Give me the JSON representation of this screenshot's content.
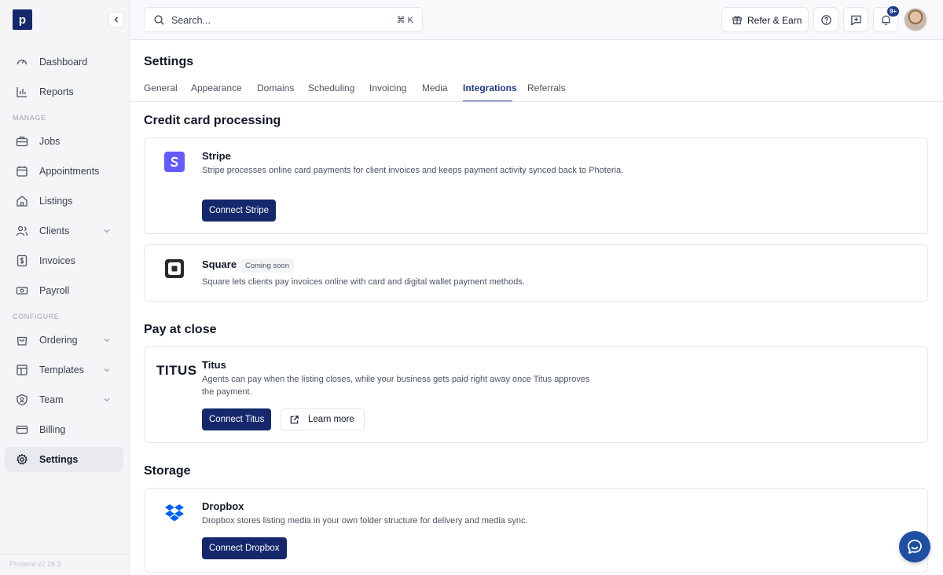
{
  "app": {
    "logo_letter": "p",
    "version": "Photeria v2.28.3"
  },
  "sidebar": {
    "items_top": [
      {
        "label": "Dashboard",
        "icon": "gauge-icon"
      },
      {
        "label": "Reports",
        "icon": "bar-chart-icon"
      }
    ],
    "manage_label": "MANAGE",
    "items_manage": [
      {
        "label": "Jobs",
        "icon": "briefcase-icon"
      },
      {
        "label": "Appointments",
        "icon": "calendar-icon"
      },
      {
        "label": "Listings",
        "icon": "house-icon"
      },
      {
        "label": "Clients",
        "icon": "users-icon",
        "expandable": true
      },
      {
        "label": "Invoices",
        "icon": "dollar-doc-icon"
      },
      {
        "label": "Payroll",
        "icon": "banknote-icon"
      }
    ],
    "configure_label": "CONFIGURE",
    "items_configure": [
      {
        "label": "Ordering",
        "icon": "shopping-bag-icon",
        "expandable": true
      },
      {
        "label": "Templates",
        "icon": "layout-icon",
        "expandable": true
      },
      {
        "label": "Team",
        "icon": "shield-user-icon",
        "expandable": true
      },
      {
        "label": "Billing",
        "icon": "credit-card-icon"
      },
      {
        "label": "Settings",
        "icon": "gear-icon",
        "active": true
      }
    ]
  },
  "header": {
    "search_placeholder": "Search...",
    "search_shortcut": "⌘ K",
    "refer_label": "Refer & Earn",
    "notification_badge": "9+"
  },
  "main": {
    "title": "Settings",
    "tabs": [
      "General",
      "Appearance",
      "Domains",
      "Scheduling",
      "Invoicing",
      "Media",
      "Integrations",
      "Referrals"
    ],
    "active_tab": "Integrations",
    "sections": {
      "credit": {
        "title": "Credit card processing",
        "stripe": {
          "name": "Stripe",
          "desc": "Stripe processes online card payments for client invoices and keeps payment activity synced back to Photeria.",
          "button": "Connect Stripe"
        },
        "square": {
          "name": "Square",
          "chip": "Coming soon",
          "desc": "Square lets clients pay invoices online with card and digital wallet payment methods."
        }
      },
      "close": {
        "title": "Pay at close",
        "titus": {
          "logo_text": "TITUS",
          "name": "Titus",
          "desc": "Agents can pay when the listing closes, while your business gets paid right away once Titus approves the payment.",
          "button": "Connect Titus",
          "learn_more": "Learn more"
        }
      },
      "storage": {
        "title": "Storage",
        "dropbox": {
          "name": "Dropbox",
          "desc": "Dropbox stores listing media in your own folder structure for delivery and media sync.",
          "button": "Connect Dropbox"
        }
      }
    }
  },
  "colors": {
    "brand": "#14286b",
    "stripe": "#635bff",
    "dropbox": "#0061fe",
    "chat": "#1e4fa3"
  }
}
